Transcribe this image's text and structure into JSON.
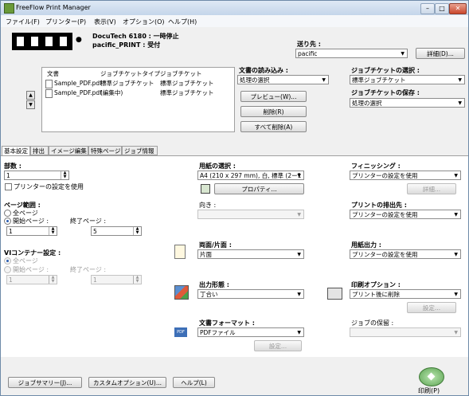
{
  "window": {
    "title": "FreeFlow Print Manager",
    "controls": [
      "–",
      "□",
      "✕"
    ]
  },
  "menu": [
    "ファイル(F)",
    "プリンター(P)",
    "表示(V)",
    "オプション(O)",
    "ヘルプ(H)"
  ],
  "printer": {
    "line1": "DocuTech 6180 : 一時停止",
    "line2": "pacific_PRINT : 受付"
  },
  "destination": {
    "label": "送り先 :",
    "value": "pacific",
    "details_button": "詳細(D)..."
  },
  "documents": {
    "headers": [
      "文書",
      "ジョブチケットタイプ",
      "ジョブチケット"
    ],
    "rows": [
      {
        "name": "Sample_PDF.pdf",
        "type": "標準ジョブチケット",
        "ticket": "標準ジョブチケット"
      },
      {
        "name": "Sample_PDF.pdf",
        "type": "(編集中)",
        "ticket": "標準ジョブチケット"
      }
    ]
  },
  "document_import": {
    "label": "文書の読み込み :",
    "value": "処理の選択",
    "preview_button": "プレビュー(W)...",
    "delete_button": "削除(R)",
    "delete_all_button": "すべて削除(A)"
  },
  "job_ticket": {
    "select_label": "ジョブチケットの選択 :",
    "select_value": "標準ジョブチケット",
    "save_label": "ジョブチケットの保存 :",
    "save_value": "処理の選択"
  },
  "tabs": [
    "基本設定",
    "排出",
    "イメージ編集",
    "特殊ページ",
    "ジョブ情報"
  ],
  "basic": {
    "copies_label": "部数 :",
    "copies_value": "1",
    "use_printer_setting": "プリンターの設定を使用",
    "page_range_label": "ページ範囲 :",
    "all_pages": "全ページ",
    "start_page": "開始ページ :",
    "end_page": "終了ページ :",
    "start_value": "1",
    "end_value": "5",
    "vi_label": "VIコンテナー設定 :",
    "vi_all": "全ページ",
    "vi_start": "開始ページ :",
    "vi_end": "終了ページ :",
    "vi_start_value": "1",
    "vi_end_value": "1"
  },
  "paper": {
    "select_label": "用紙の選択 :",
    "select_value": "A4 (210 x 297 mm), 白, 標準 (2ー1",
    "properties_button": "プロパティ...",
    "orientation_label": "向き :",
    "duplex_label": "両面/片面 :",
    "duplex_value": "片面",
    "output_label": "出力形態 :",
    "output_value": "丁合い",
    "format_label": "文書フォーマット :",
    "format_value": "PDFファイル",
    "format_settings": "設定..."
  },
  "finishing": {
    "label": "フィニッシング :",
    "value": "プリンターの設定を使用",
    "details": "詳細...",
    "print_output_label": "プリントの排出先 :",
    "print_output_value": "プリンターの設定を使用",
    "paper_out_label": "用紙出力 :",
    "paper_out_value": "プリンターの設定を使用",
    "print_options_label": "印刷オプション :",
    "print_options_value": "プリント後に削除",
    "print_options_settings": "設定...",
    "job_save_label": "ジョブの保留 :"
  },
  "footer": {
    "job_summary": "ジョブサマリー(J)...",
    "custom_options": "カスタムオプション(U)...",
    "help": "ヘルプ(L)",
    "print": "印刷(P)"
  }
}
